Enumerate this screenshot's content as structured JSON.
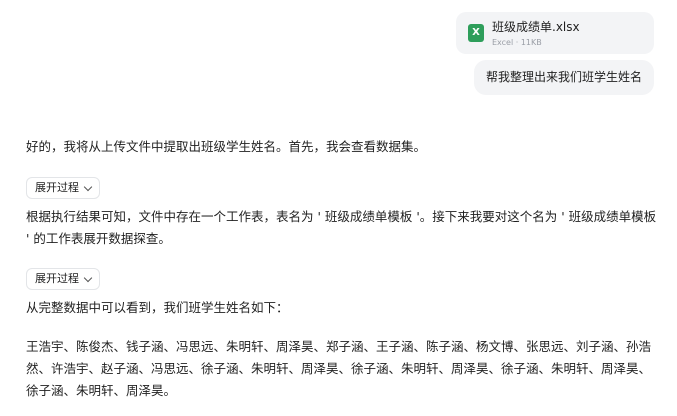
{
  "attachment": {
    "icon": "excel-icon",
    "icon_letter": "X",
    "icon_color": "#2e9e5b",
    "file_name": "班级成绩单.xlsx",
    "file_meta": "Excel · 11KB"
  },
  "user_message": "帮我整理出来我们班学生姓名",
  "assistant": {
    "intro": "好的，我将从上传文件中提取出班级学生姓名。首先，我会查看数据集。",
    "expand_label_1": "展开过程",
    "paragraph_2": "根据执行结果可知，文件中存在一个工作表，表名为 ' 班级成绩单模板 '。接下来我要对这个名为 ' 班级成绩单模板 ' 的工作表展开数据探查。",
    "expand_label_2": "展开过程",
    "paragraph_3": "从完整数据中可以看到，我们班学生姓名如下：",
    "names": "王浩宇、陈俊杰、钱子涵、冯思远、朱明轩、周泽昊、郑子涵、王子涵、陈子涵、杨文博、张思远、刘子涵、孙浩然、许浩宇、赵子涵、冯思远、徐子涵、朱明轩、周泽昊、徐子涵、朱明轩、周泽昊、徐子涵、朱明轩、周泽昊、徐子涵、朱明轩、周泽昊。"
  }
}
